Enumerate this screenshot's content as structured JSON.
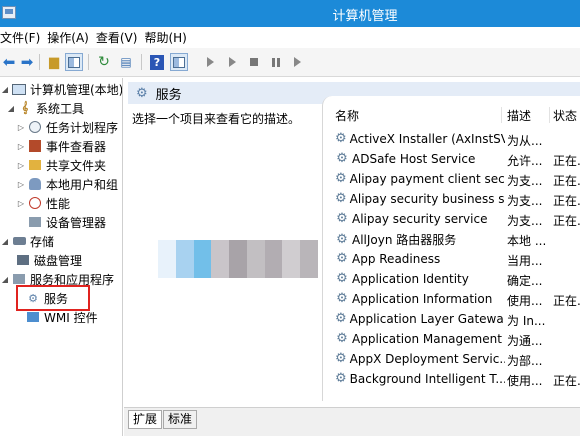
{
  "window": {
    "title": "计算机管理"
  },
  "menu": [
    "文件(F)",
    "操作(A)",
    "查看(V)",
    "帮助(H)"
  ],
  "tree": {
    "root": "计算机管理(本地)",
    "system_tools": "系统工具",
    "task_scheduler": "任务计划程序",
    "event_viewer": "事件查看器",
    "shared_folders": "共享文件夹",
    "local_users": "本地用户和组",
    "performance": "性能",
    "device_manager": "设备管理器",
    "storage": "存储",
    "disk_management": "磁盘管理",
    "services_apps": "服务和应用程序",
    "services": "服务",
    "wmi": "WMI 控件"
  },
  "panel": {
    "title": "服务",
    "description": "选择一个项目来查看它的描述。"
  },
  "columns": {
    "name": "名称",
    "desc": "描述",
    "status": "状态"
  },
  "services": [
    {
      "name": "ActiveX Installer (AxInstSV)",
      "desc": "为从...",
      "status": ""
    },
    {
      "name": "ADSafe Host Service",
      "desc": "允许...",
      "status": "正在..."
    },
    {
      "name": "Alipay payment client sec...",
      "desc": "为支...",
      "status": "正在..."
    },
    {
      "name": "Alipay security business s...",
      "desc": "为支...",
      "status": "正在..."
    },
    {
      "name": "Alipay security service",
      "desc": "为支...",
      "status": "正在..."
    },
    {
      "name": "AllJoyn 路由器服务",
      "desc": "本地 ...",
      "status": ""
    },
    {
      "name": "App Readiness",
      "desc": "当用...",
      "status": ""
    },
    {
      "name": "Application Identity",
      "desc": "确定...",
      "status": ""
    },
    {
      "name": "Application Information",
      "desc": "使用...",
      "status": "正在..."
    },
    {
      "name": "Application Layer Gatewa...",
      "desc": "为 In...",
      "status": ""
    },
    {
      "name": "Application Management",
      "desc": "为通...",
      "status": ""
    },
    {
      "name": "AppX Deployment Servic...",
      "desc": "为部...",
      "status": ""
    },
    {
      "name": "Background Intelligent T...",
      "desc": "使用...",
      "status": "正在..."
    }
  ],
  "tabs": {
    "extended": "扩展",
    "standard": "标准"
  },
  "icons": {
    "back": "arrow-left-icon",
    "forward": "arrow-right-icon",
    "up": "folder-up-icon",
    "tree": "show-tree-icon",
    "refresh": "refresh-icon",
    "export": "export-icon",
    "help": "help-icon",
    "properties": "properties-icon",
    "start": "play-icon",
    "start2": "play-icon",
    "stop": "stop-icon",
    "pause": "pause-icon",
    "restart": "restart-icon"
  },
  "colors": {
    "titlebar": "#1c8ad8",
    "highlight": "#e0231f",
    "panel_header": "#e4ecf7"
  }
}
